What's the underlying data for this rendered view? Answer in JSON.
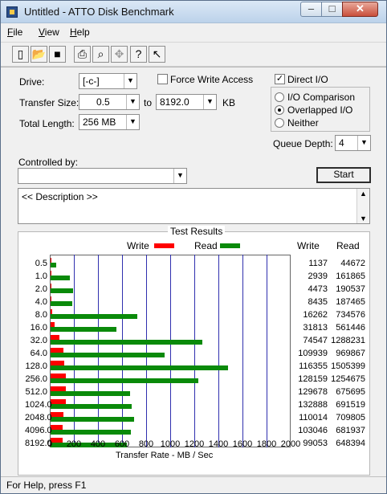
{
  "window": {
    "title": "Untitled - ATTO Disk Benchmark"
  },
  "menu": [
    {
      "label": "File",
      "underline": "F"
    },
    {
      "label": "View",
      "underline": "V"
    },
    {
      "label": "Help",
      "underline": "H"
    }
  ],
  "toolbar_icons": [
    "new-icon",
    "open-icon",
    "save-icon",
    "print-icon",
    "print-preview-icon",
    "move-icon",
    "help-icon",
    "context-help-icon"
  ],
  "form": {
    "drive_label": "Drive:",
    "drive_value": "[-c-]",
    "force_write_label": "Force Write Access",
    "direct_io_label": "Direct I/O",
    "transfer_size_label": "Transfer Size:",
    "transfer_from": "0.5",
    "to_label": "to",
    "transfer_to": "8192.0",
    "kb_label": "KB",
    "total_length_label": "Total Length:",
    "total_length": "256 MB",
    "io_comparison": "I/O Comparison",
    "overlapped_io": "Overlapped I/O",
    "neither": "Neither",
    "queue_depth_label": "Queue Depth:",
    "queue_depth": "4",
    "controlled_by_label": "Controlled by:",
    "controlled_by_value": "",
    "start_label": "Start",
    "description": "<< Description >>",
    "direct_io_checked": true,
    "force_write_checked": false
  },
  "results": {
    "title": "Test Results",
    "write_legend": "Write",
    "read_legend": "Read",
    "write_col": "Write",
    "read_col": "Read",
    "axis_label": "Transfer Rate - MB / Sec"
  },
  "chart_data": {
    "type": "bar",
    "title": "Test Results",
    "xlabel": "Transfer Rate - MB / Sec",
    "xlim": [
      0,
      2000
    ],
    "x_ticks": [
      "0",
      "200",
      "400",
      "600",
      "800",
      "1000",
      "1200",
      "1400",
      "1600",
      "1800",
      "2000"
    ],
    "categories": [
      "0.5",
      "1.0",
      "2.0",
      "4.0",
      "8.0",
      "16.0",
      "32.0",
      "64.0",
      "128.0",
      "256.0",
      "512.0",
      "1024.0",
      "2048.0",
      "4096.0",
      "8192.0"
    ],
    "series": [
      {
        "name": "Write",
        "color": "#ff0000",
        "values": [
          1137,
          2939,
          4473,
          8435,
          16262,
          31813,
          74547,
          109939,
          116355,
          128159,
          129678,
          132888,
          110014,
          103046,
          99053
        ]
      },
      {
        "name": "Read",
        "color": "#0a8a0a",
        "values": [
          44672,
          161865,
          190537,
          187465,
          734576,
          561446,
          1288231,
          969867,
          1505399,
          1254675,
          675695,
          691519,
          709805,
          681937,
          648394
        ]
      }
    ],
    "value_unit": "KB/s",
    "legend": "top"
  },
  "status": "For Help, press F1"
}
